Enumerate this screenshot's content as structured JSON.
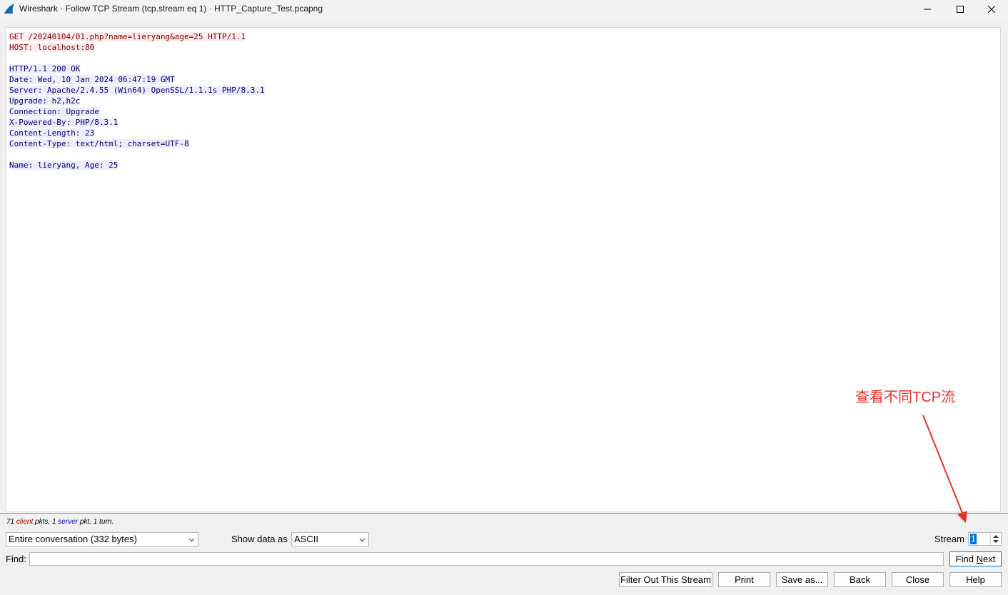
{
  "window": {
    "title": "Wireshark · Follow TCP Stream (tcp.stream eq 1) · HTTP_Capture_Test.pcapng"
  },
  "stream_text": {
    "client_lines": [
      "GET /20240104/01.php?name=lieryang&age=25 HTTP/1.1",
      "HOST: localhost:80"
    ],
    "server_lines": [
      "HTTP/1.1 200 OK",
      "Date: Wed, 10 Jan 2024 06:47:19 GMT",
      "Server: Apache/2.4.55 (Win64) OpenSSL/1.1.1s PHP/8.3.1",
      "Upgrade: h2,h2c",
      "Connection: Upgrade",
      "X-Powered-By: PHP/8.3.1",
      "Content-Length: 23",
      "Content-Type: text/html; charset=UTF-8"
    ],
    "body_line": "Name: lieryang, Age: 25"
  },
  "status": {
    "client_count": "71",
    "client_word": "client",
    "client_suffix": "pkts,",
    "server_count": "1",
    "server_word": "server",
    "server_suffix": "pkt, 1 turn."
  },
  "controls": {
    "conversation_select": "Entire conversation (332 bytes)",
    "show_data_label": "Show data as",
    "show_data_select": "ASCII",
    "stream_label": "Stream",
    "stream_value": "1",
    "find_label": "Find:",
    "find_value": "",
    "find_next_prefix": "Find ",
    "find_next_accel": "N",
    "find_next_suffix": "ext"
  },
  "buttons": {
    "filter_out": "Filter Out This Stream",
    "print": "Print",
    "save_as": "Save as...",
    "back": "Back",
    "close": "Close",
    "help": "Help"
  },
  "annotation": {
    "text": "查看不同TCP流"
  },
  "colors": {
    "client_bg": "#fbeded",
    "client_fg": "#7f0000",
    "server_bg": "#ededfb",
    "server_fg": "#00007f",
    "annotation": "#e8302a"
  }
}
